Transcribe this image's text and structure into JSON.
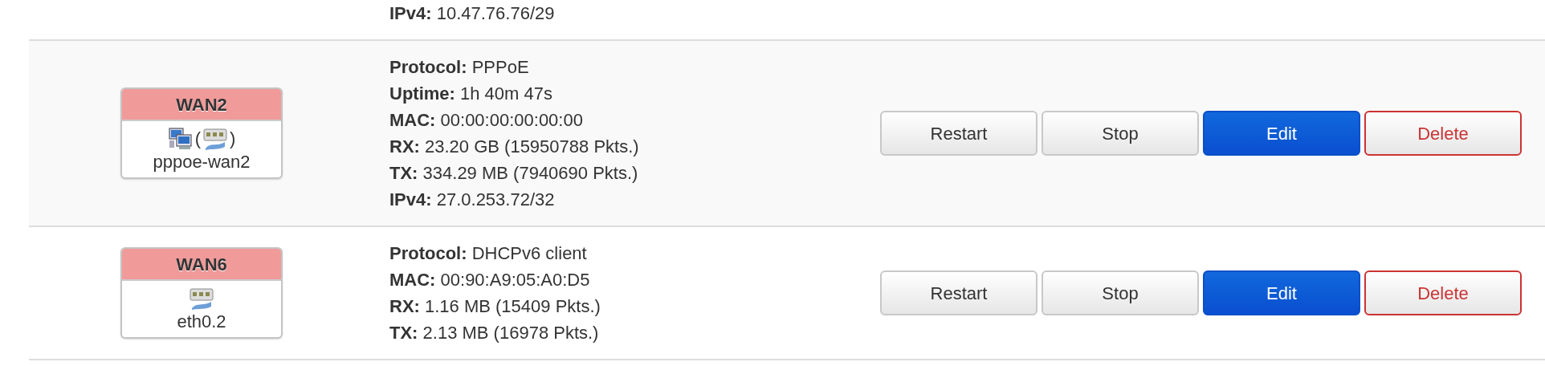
{
  "interfaces": [
    {
      "partial": true,
      "details": [
        {
          "label": "IPv4:",
          "value": "10.47.76.76/29"
        }
      ]
    },
    {
      "name": "WAN2",
      "color": "#f09a9a",
      "icons": [
        {
          "kind": "computers"
        },
        {
          "kind": "ethernet",
          "prefix": "(",
          "suffix": ")"
        }
      ],
      "device": "pppoe-wan2",
      "details": [
        {
          "label": "Protocol:",
          "value": "PPPoE"
        },
        {
          "label": "Uptime:",
          "value": "1h 40m 47s"
        },
        {
          "label": "MAC:",
          "value": "00:00:00:00:00:00"
        },
        {
          "label": "RX:",
          "value": "23.20 GB (15950788 Pkts.)"
        },
        {
          "label": "TX:",
          "value": "334.29 MB (7940690 Pkts.)"
        },
        {
          "label": "IPv4:",
          "value": "27.0.253.72/32"
        }
      ],
      "buttons": [
        {
          "label": "Restart",
          "kind": "default"
        },
        {
          "label": "Stop",
          "kind": "default"
        },
        {
          "label": "Edit",
          "kind": "primary"
        },
        {
          "label": "Delete",
          "kind": "danger"
        }
      ]
    },
    {
      "name": "WAN6",
      "color": "#f09a9a",
      "icons": [
        {
          "kind": "ethernet"
        }
      ],
      "device": "eth0.2",
      "details": [
        {
          "label": "Protocol:",
          "value": "DHCPv6 client"
        },
        {
          "label": "MAC:",
          "value": "00:90:A9:05:A0:D5"
        },
        {
          "label": "RX:",
          "value": "1.16 MB (15409 Pkts.)"
        },
        {
          "label": "TX:",
          "value": "2.13 MB (16978 Pkts.)"
        }
      ],
      "buttons": [
        {
          "label": "Restart",
          "kind": "default"
        },
        {
          "label": "Stop",
          "kind": "default"
        },
        {
          "label": "Edit",
          "kind": "primary"
        },
        {
          "label": "Delete",
          "kind": "danger"
        }
      ]
    }
  ]
}
